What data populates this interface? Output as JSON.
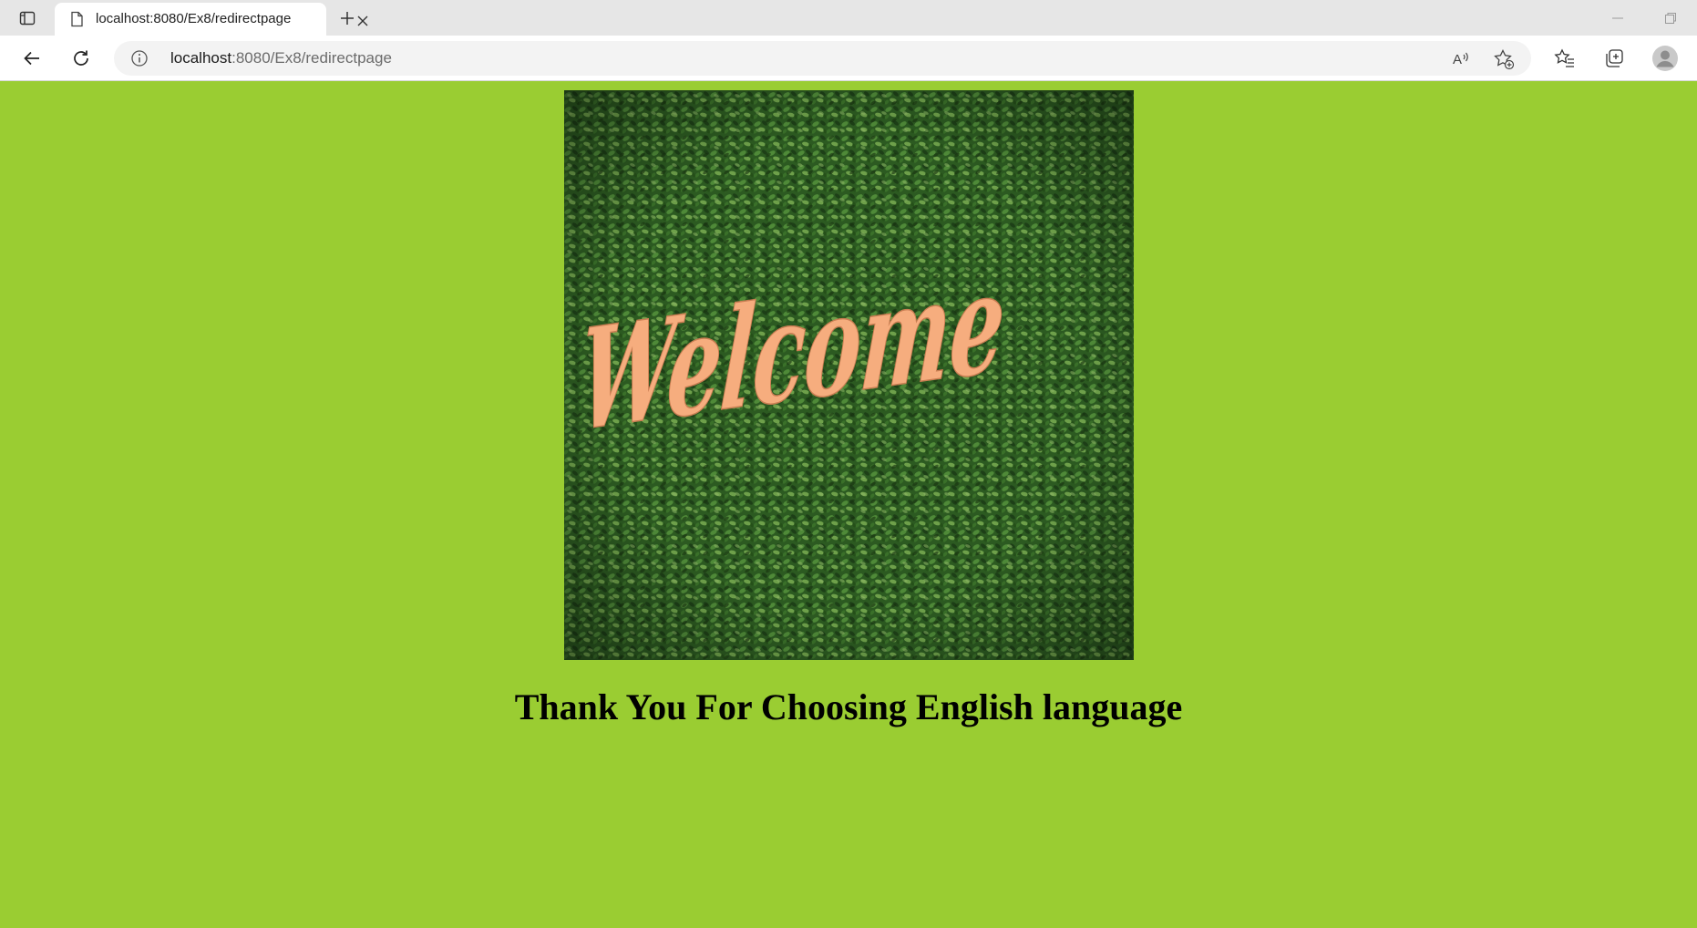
{
  "browser": {
    "tab": {
      "title": "localhost:8080/Ex8/redirectpage"
    },
    "address": {
      "host": "localhost",
      "path": ":8080/Ex8/redirectpage"
    },
    "icons": {
      "tab_actions": "tab-actions-icon",
      "favicon": "page-icon",
      "close": "close-icon",
      "new_tab": "plus-icon",
      "back": "back-arrow-icon",
      "reload": "reload-icon",
      "site_info": "info-icon",
      "read_aloud": "read-aloud-icon",
      "add_favorite": "star-plus-icon",
      "favorites": "favorites-icon",
      "collections": "collections-icon",
      "profile": "profile-icon"
    }
  },
  "page": {
    "background_color": "#9acd32",
    "image": {
      "text": "Welcome",
      "text_color": "#f6ad7e"
    },
    "heading": "Thank You For Choosing English language"
  }
}
